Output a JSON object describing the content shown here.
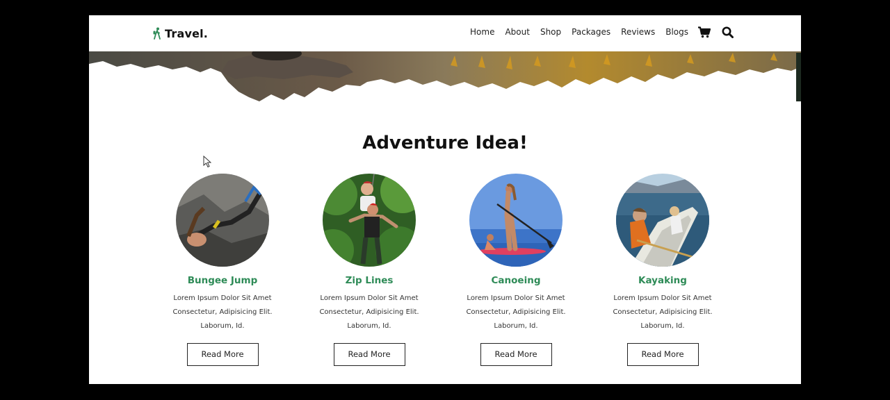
{
  "header": {
    "logo_text": "Travel.",
    "nav": [
      "Home",
      "About",
      "Shop",
      "Packages",
      "Reviews",
      "Blogs"
    ]
  },
  "section": {
    "title": "Adventure Idea!"
  },
  "cards": [
    {
      "title": "Bungee Jump",
      "lines": [
        "Lorem Ipsum Dolor Sit Amet",
        "Consectetur, Adipisicing Elit.",
        "Laborum, Id."
      ],
      "button": "Read More"
    },
    {
      "title": "Zip Lines",
      "lines": [
        "Lorem Ipsum Dolor Sit Amet",
        "Consectetur, Adipisicing Elit.",
        "Laborum, Id."
      ],
      "button": "Read More"
    },
    {
      "title": "Canoeing",
      "lines": [
        "Lorem Ipsum Dolor Sit Amet",
        "Consectetur, Adipisicing Elit.",
        "Laborum, Id."
      ],
      "button": "Read More"
    },
    {
      "title": "Kayaking",
      "lines": [
        "Lorem Ipsum Dolor Sit Amet",
        "Consectetur, Adipisicing Elit.",
        "Laborum, Id."
      ],
      "button": "Read More"
    }
  ],
  "colors": {
    "accent": "#2e8b57",
    "heading": "#111111",
    "frame": "#000000"
  },
  "icons": [
    "hiker-logo-icon",
    "cart-icon",
    "search-icon"
  ]
}
